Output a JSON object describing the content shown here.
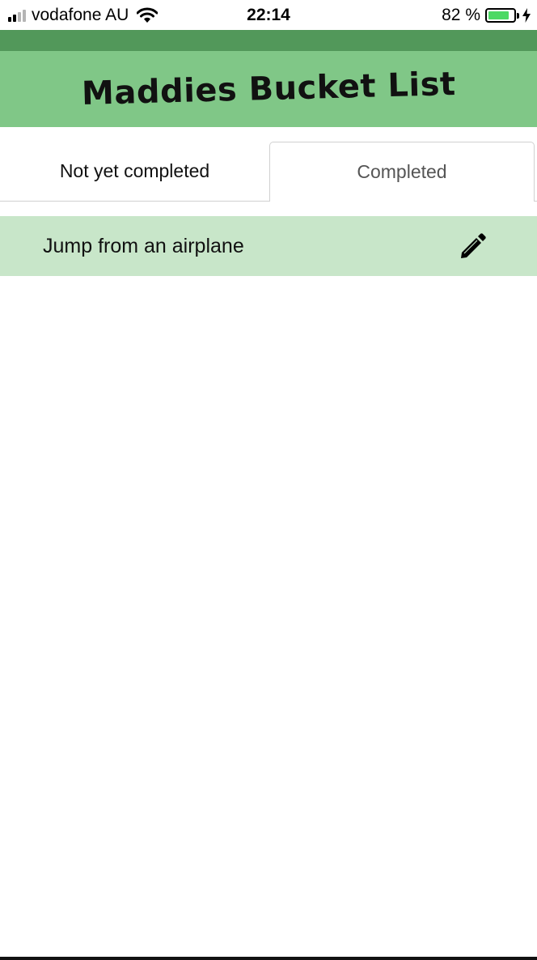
{
  "status_bar": {
    "carrier": "vodafone AU",
    "time": "22:14",
    "battery_percent": "82 %",
    "battery_level": 0.82,
    "signal_bars_filled": 2,
    "signal_bars_total": 4,
    "icons": [
      "signal-icon",
      "wifi-icon",
      "battery-icon",
      "charging-bolt-icon"
    ]
  },
  "header": {
    "title": "Maddies Bucket List"
  },
  "tabs": [
    {
      "label": "Not yet completed",
      "active": false
    },
    {
      "label": "Completed",
      "active": true
    }
  ],
  "items": [
    {
      "label": "Jump from an airplane",
      "action_icon": "pencil-edit-icon"
    }
  ],
  "colors": {
    "header_dark": "#52985a",
    "header": "#80c787",
    "item_background": "#c8e6c9",
    "battery_fill": "#4cd964"
  }
}
